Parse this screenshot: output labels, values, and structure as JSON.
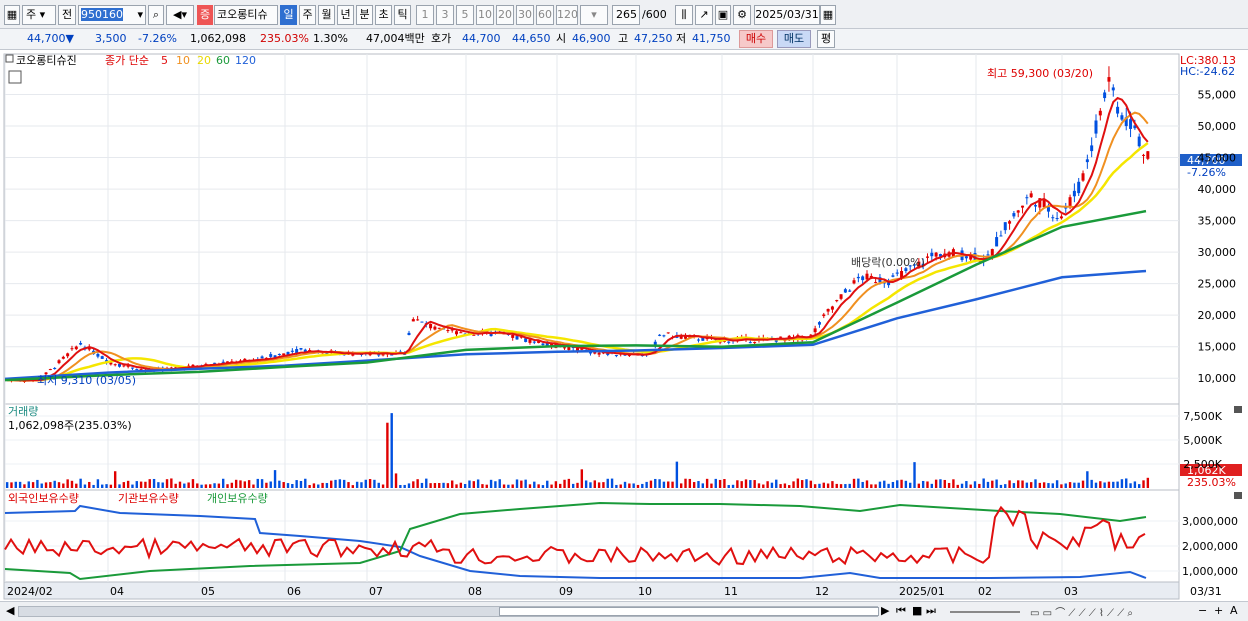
{
  "toolbar": {
    "market": "주",
    "prev": "전",
    "code": "950160",
    "theme_badge": "증",
    "stock_name": "코오롱티슈",
    "periods": [
      "일",
      "주",
      "월",
      "년",
      "분",
      "초",
      "틱"
    ],
    "intervals": [
      "1",
      "3",
      "5",
      "10",
      "20",
      "30",
      "60",
      "120"
    ],
    "count": "265",
    "count_max": "/600",
    "date": "2025/03/31"
  },
  "info": {
    "price": "44,700▼",
    "change": "3,500",
    "change_pct": "-7.26%",
    "volume": "1,062,098",
    "volume_pct": "235.03%",
    "turnover": "1.30%",
    "amount": "47,004백만",
    "quote_label": "호가",
    "ask": "44,700",
    "bid": "44,650",
    "open_label": "시",
    "open": "46,900",
    "high_label": "고",
    "high": "47,250",
    "low_label": "저",
    "low": "41,750",
    "buy_btn": "매수",
    "sell_btn": "매도",
    "eval_btn": "평"
  },
  "price_panel": {
    "title": "코오롱티슈진",
    "legend_prefix": "종가 단순",
    "ma_labels": [
      "5",
      "10",
      "20",
      "60",
      "120"
    ],
    "lc": "LC:380.13",
    "hc": "HC:-24.62",
    "high_mark": "최고 59,300 (03/20)",
    "low_mark": "최저 9,310 (03/05)",
    "dividend_mark": "배당락(0.00%)",
    "y_ticks": [
      "55,000",
      "50,000",
      "45,000",
      "40,000",
      "35,000",
      "30,000",
      "25,000",
      "20,000",
      "15,000",
      "10,000"
    ],
    "current_price": "44,700",
    "current_pct": "-7.26%"
  },
  "volume_panel": {
    "title": "거래량",
    "value": "1,062,098주(235.03%)",
    "y_ticks": [
      "7,500K",
      "5,000K",
      "2,500K"
    ],
    "current": "1,062K",
    "current_pct": "235.03%"
  },
  "holder_panel": {
    "foreign": "외국인보유수량",
    "institution": "기관보유수량",
    "individual": "개인보유수량",
    "y_ticks": [
      "3,000,000",
      "2,000,000",
      "1,000,000"
    ]
  },
  "x_axis": [
    "2024/02",
    "04",
    "05",
    "06",
    "07",
    "08",
    "09",
    "10",
    "11",
    "12",
    "2025/01",
    "02",
    "03",
    "03/31"
  ],
  "colors": {
    "up": "#e00000",
    "down": "#0050e0",
    "ma5": "#e01010",
    "ma10": "#f09020",
    "ma20": "#f5e600",
    "ma60": "#1a9a3a",
    "ma120": "#2060d8"
  },
  "chart_data": {
    "type": "line",
    "x": [
      "2024/02",
      "04",
      "05",
      "06",
      "07",
      "08",
      "09",
      "10",
      "11",
      "12",
      "2025/01",
      "02",
      "03",
      "03/31"
    ],
    "series": [
      {
        "name": "120",
        "values": [
          9900,
          10900,
          11500,
          12000,
          12800,
          13800,
          14200,
          14400,
          14800,
          15300,
          19500,
          22500,
          26000,
          27000
        ]
      },
      {
        "name": "60",
        "values": [
          9700,
          10500,
          11000,
          11800,
          12500,
          14500,
          15100,
          15200,
          15000,
          15700,
          22000,
          28000,
          34000,
          36500
        ]
      }
    ]
  }
}
